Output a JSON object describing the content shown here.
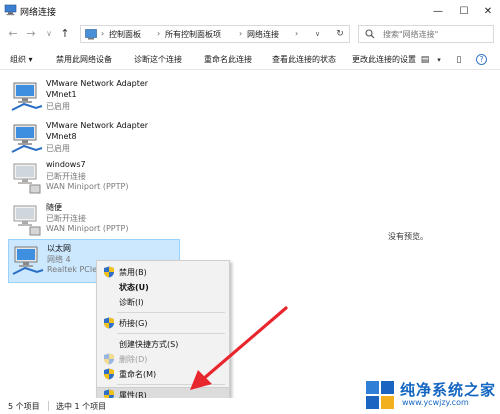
{
  "window": {
    "title": "网络连接",
    "buttons": {
      "minimize": "—",
      "maximize": "☐",
      "close": "✕"
    }
  },
  "nav": {
    "back_icon": "←",
    "forward_icon": "→",
    "dropdown_icon": "∨",
    "up_icon": "↑",
    "breadcrumb": [
      "控制面板",
      "所有控制面板项",
      "网络连接"
    ],
    "separator": "›",
    "search_placeholder": "搜索\"网络连接\""
  },
  "toolbar": {
    "organize": "组织 ▾",
    "items": [
      "禁用此网络设备",
      "诊断这个连接",
      "重命名此连接",
      "查看此连接的状态",
      "更改此连接的设置"
    ],
    "view_icon": "▤",
    "dropdown": "▾",
    "help": "?"
  },
  "connections": [
    {
      "name": "VMware Network Adapter",
      "line2": "VMnet1",
      "line3": "已启用",
      "enabled": true
    },
    {
      "name": "VMware Network Adapter",
      "line2": "VMnet8",
      "line3": "已启用",
      "enabled": true
    },
    {
      "name": "windows7",
      "line2": "已断开连接",
      "line3": "WAN Miniport (PPTP)",
      "enabled": false
    },
    {
      "name": "随便",
      "line2": "已断开连接",
      "line3": "WAN Miniport (PPTP)",
      "enabled": false
    },
    {
      "name": "以太网",
      "line2": "网络 4",
      "line3": "Realtek PCIe",
      "enabled": true,
      "selected": true
    }
  ],
  "preview_text": "没有预览。",
  "context_menu": {
    "items": [
      {
        "label": "禁用(B)",
        "icon": "shield-icon",
        "style": "normal"
      },
      {
        "label": "状态(U)",
        "icon": "",
        "style": "bold"
      },
      {
        "label": "诊断(I)",
        "icon": "",
        "style": "normal"
      },
      {
        "label": "桥接(G)",
        "icon": "shield-icon",
        "style": "normal"
      },
      {
        "label": "创建快捷方式(S)",
        "icon": "",
        "style": "normal"
      },
      {
        "label": "删除(D)",
        "icon": "shield-icon",
        "style": "disabled"
      },
      {
        "label": "重命名(M)",
        "icon": "shield-icon",
        "style": "normal"
      },
      {
        "label": "属性(R)",
        "icon": "shield-icon",
        "style": "hover"
      }
    ]
  },
  "status": {
    "count": "5 个项目",
    "selected": "选中 1 个项目"
  },
  "watermark": {
    "brand": "纯净系统之家",
    "url": "www.ycwjzy.com"
  },
  "colors": {
    "selection": "#cce8ff",
    "selection_border": "#99d1ff",
    "arrow": "#e8262d",
    "brand": "#1466c2"
  }
}
